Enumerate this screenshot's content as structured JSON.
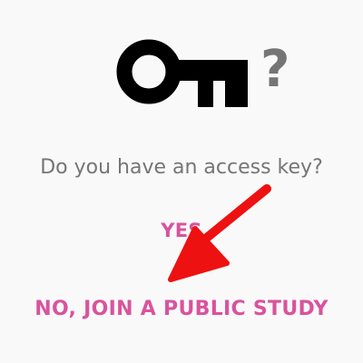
{
  "prompt": {
    "icon": "key-icon",
    "question_mark": "?",
    "text": "Do you have an access key?"
  },
  "actions": {
    "yes_label": "YES",
    "no_label": "NO, JOIN A PUBLIC STUDY"
  },
  "annotation": {
    "icon": "arrow-icon",
    "color": "#ee1111"
  },
  "colors": {
    "background": "#f9f9f9",
    "text": "#757575",
    "accent": "#d9539e",
    "icon": "#000000"
  }
}
